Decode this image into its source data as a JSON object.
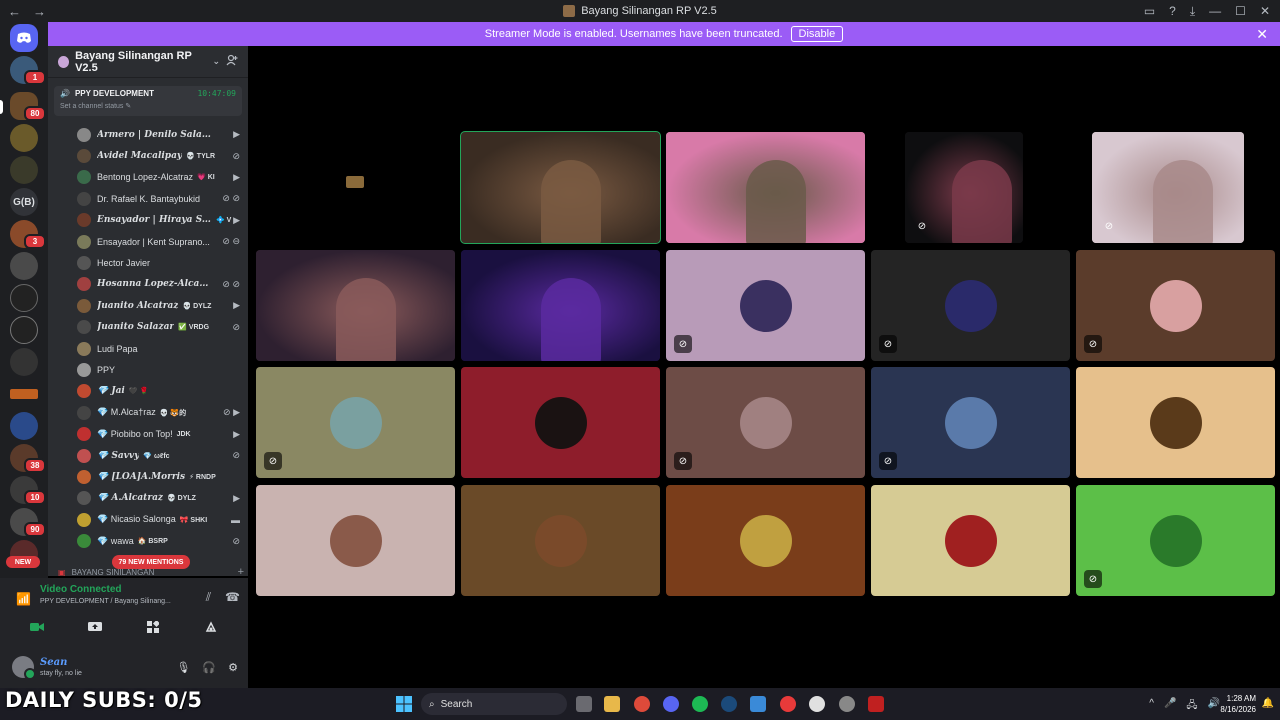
{
  "window": {
    "title": "Bayang Silinangan RP V2.5",
    "back": "←",
    "forward": "→",
    "ctrl_inbox": "▭",
    "ctrl_help": "?",
    "ctrl_download": "⤓",
    "ctrl_min": "—",
    "ctrl_max": "☐",
    "ctrl_close": "✕"
  },
  "banner": {
    "text": "Streamer Mode is enabled. Usernames have been truncated.",
    "button": "Disable",
    "close": "✕",
    "color": "#9b5cf6"
  },
  "rail": {
    "home_icon": "discord-logo-icon",
    "badges": [
      "1",
      "80",
      "3",
      "38",
      "10",
      "90"
    ],
    "text_server": "G(B)",
    "new_label": "NEW"
  },
  "server": {
    "name": "Bayang Silinangan RP V2.5",
    "chevron": "⌄",
    "invite_icon": "add-member-icon"
  },
  "voice_channel": {
    "name": "PPY DEVELOPMENT",
    "timer": "10:47:09",
    "status_prompt": "Set a channel status",
    "edit_icon": "✎"
  },
  "voice_users": [
    {
      "name": "Armero | Denilo Salamanca",
      "tag": "",
      "fancy": true,
      "status": "▶",
      "color": "#888"
    },
    {
      "name": "Avidel Macalipay",
      "tag": "💀 TYLR",
      "fancy": true,
      "status": "⊘",
      "color": "#5a4a3a"
    },
    {
      "name": "Bentong Lopez-Alcatraz",
      "tag": "💗 KI",
      "fancy": false,
      "status": "▶",
      "color": "#3a6a4a"
    },
    {
      "name": "Dr. Rafael K. Bantaybukid",
      "tag": "",
      "fancy": false,
      "status": "⊘ ⊘",
      "color": "#444"
    },
    {
      "name": "Ensayador | Hiraya S.Alonzo",
      "tag": "💠 V",
      "fancy": true,
      "status": "▶",
      "color": "#6a3a2a"
    },
    {
      "name": "Ensayador | Kent Suprano...",
      "tag": "",
      "fancy": false,
      "status": "⊘ ⊖",
      "color": "#7a7a5a"
    },
    {
      "name": "Hector Javier",
      "tag": "",
      "fancy": false,
      "status": "",
      "color": "#555"
    },
    {
      "name": "Hosanna Lopez-Alcatraz",
      "tag": "",
      "fancy": true,
      "status": "⊘ ⊘",
      "color": "#a04040"
    },
    {
      "name": "Juanito Alcatraz",
      "tag": "💀 DYLZ",
      "fancy": true,
      "status": "▶",
      "color": "#7a5a3a"
    },
    {
      "name": "Juanito Salazar",
      "tag": "✅ VRDG",
      "fancy": true,
      "status": "⊘",
      "color": "#4a4a4a"
    },
    {
      "name": "Ludi Papa",
      "tag": "",
      "fancy": false,
      "status": "",
      "color": "#8a7a5a"
    },
    {
      "name": "PPY",
      "tag": "",
      "fancy": false,
      "status": "",
      "color": "#999"
    },
    {
      "name": "💎 Jai",
      "tag": "🖤 🌹",
      "fancy": true,
      "status": "",
      "color": "#c04a30"
    },
    {
      "name": "💎 M.Alca†raz",
      "tag": "💀 🐯的",
      "fancy": false,
      "status": "⊘ ▶",
      "color": "#444"
    },
    {
      "name": "💎 Piobibo on Top!",
      "tag": "JDK",
      "fancy": false,
      "status": "▶",
      "color": "#c03030"
    },
    {
      "name": "💎 Savvy",
      "tag": "💎 ωℓfc",
      "fancy": true,
      "status": "⊘",
      "color": "#c05050"
    },
    {
      "name": "💎 [LOA]A.Morris",
      "tag": "⚡ RNDP",
      "fancy": true,
      "status": "",
      "color": "#c06030"
    },
    {
      "name": "💎 A.Alcatraz",
      "tag": "💀 DYLZ",
      "fancy": true,
      "status": "▶",
      "color": "#555"
    },
    {
      "name": "💎 Nicasio Salonga",
      "tag": "🎀 SHKI",
      "fancy": false,
      "status": "▬",
      "color": "#c0a030"
    },
    {
      "name": "💎 wawa",
      "tag": "🏠 BSRP",
      "fancy": false,
      "status": "⊘",
      "color": "#3a8a3a"
    }
  ],
  "mentions_pill": "79 NEW MENTIONS",
  "next_category": "BAYANG SINILANGAN",
  "voice_panel": {
    "title": "Video Connected",
    "subtitle": "PPY DEVELOPMENT / Bayang Silinang...",
    "signal_icon": "signal-icon",
    "noise_icon": "noise-suppression-icon",
    "disconnect_icon": "disconnect-icon",
    "buttons": [
      "camera-icon",
      "screen-share-icon",
      "activities-icon",
      "soundboard-icon"
    ]
  },
  "user": {
    "name": "Sean",
    "status": "stay fly, no lie",
    "controls": [
      "mic-icon",
      "headphones-icon",
      "settings-icon"
    ]
  },
  "overlay_text": "DAILY SUBS: 0/5",
  "tiles": [
    {
      "kind": "logo",
      "bg": "#000000",
      "muted": false
    },
    {
      "kind": "video",
      "bg": "#3a2c22",
      "accent": "#7a5a42",
      "muted": false,
      "speaking": true
    },
    {
      "kind": "video",
      "bg": "#d87aa8",
      "accent": "#6a5a4a",
      "muted": false
    },
    {
      "kind": "video",
      "bg": "#0e0e10",
      "accent": "#7a3a4a",
      "muted": true
    },
    {
      "kind": "video",
      "bg": "#d8c8d0",
      "accent": "#a88a8a",
      "muted": true
    },
    {
      "kind": "video",
      "bg": "#2e2030",
      "accent": "#8a5a5a",
      "muted": false
    },
    {
      "kind": "video",
      "bg": "#1a1040",
      "accent": "#5a2aa0",
      "muted": false
    },
    {
      "kind": "avatar",
      "bg": "#b89bb8",
      "pic": "#3a3060",
      "muted": true
    },
    {
      "kind": "avatar",
      "bg": "#242424",
      "pic": "#2a2a6a",
      "muted": true
    },
    {
      "kind": "avatar",
      "bg": "#5b3c2b",
      "pic": "#d8a0a0",
      "muted": true
    },
    {
      "kind": "avatar",
      "bg": "#8a8863",
      "pic": "#7aa0a0",
      "muted": true
    },
    {
      "kind": "avatar",
      "bg": "#8e1d2b",
      "pic": "#1a1212",
      "muted": false
    },
    {
      "kind": "avatar",
      "bg": "#6d4c46",
      "pic": "#a08080",
      "muted": true
    },
    {
      "kind": "avatar",
      "bg": "#2a3552",
      "pic": "#5a7aaa",
      "muted": true
    },
    {
      "kind": "avatar",
      "bg": "#e6c08c",
      "pic": "#5a3a1a",
      "muted": false
    },
    {
      "kind": "avatar",
      "bg": "#c9b3b0",
      "pic": "#8a5a4a",
      "muted": false
    },
    {
      "kind": "avatar",
      "bg": "#6a4a28",
      "pic": "#7a4a2a",
      "muted": false
    },
    {
      "kind": "avatar",
      "bg": "#7a3d1a",
      "pic": "#c0a040",
      "muted": false
    },
    {
      "kind": "avatar",
      "bg": "#d6cb94",
      "pic": "#a02020",
      "muted": false
    },
    {
      "kind": "avatar",
      "bg": "#5cbf48",
      "pic": "#2a7a2a",
      "muted": true
    }
  ],
  "taskbar": {
    "search": "Search",
    "time": "1:28 AM",
    "date": "8/16/2026",
    "tray": [
      "^",
      "🎤",
      "🖧",
      "🔊"
    ],
    "bell": "🔔"
  }
}
